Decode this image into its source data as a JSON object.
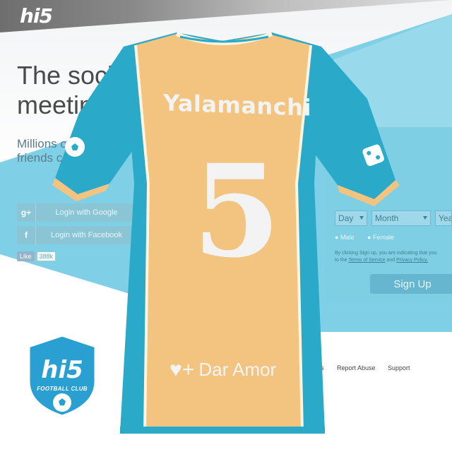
{
  "page": {
    "logo": "hi5",
    "headline_line1": "The social",
    "headline_line2": "meetin",
    "subline_line1": "Millions o",
    "subline_line2": "friends c"
  },
  "social_login": {
    "google": {
      "icon": "g+",
      "label": "Login with Google"
    },
    "facebook": {
      "icon": "f",
      "label": "Login with Facebook"
    },
    "like_label": "Like",
    "like_count": "388k"
  },
  "signup": {
    "day_placeholder": "Day",
    "month_placeholder": "Month",
    "year_placeholder": "Year",
    "male_label": "Male",
    "female_label": "Female",
    "terms_text": "By clicking Sign up, you are indicating that you",
    "terms_to": "to the",
    "terms_of_service": "Terms of Service",
    "terms_and": "and",
    "privacy_policy": "Privacy Policy.",
    "button_label": "Sign Up"
  },
  "footer": {
    "s": "s",
    "report_abuse": "Report Abuse",
    "support": "Support"
  },
  "jersey": {
    "player_name": "Yalamanchi",
    "player_number": "5",
    "sponsor_text": "Dar Amor",
    "colors": {
      "body": "#f2c47f",
      "sleeve": "#2aa9c9",
      "trim": "#fff4e0"
    }
  },
  "badge": {
    "title": "hi5",
    "subtitle": "FOOTBALL CLUB",
    "colors": {
      "fill": "#2a9fd1",
      "border": "#ffffff"
    }
  }
}
